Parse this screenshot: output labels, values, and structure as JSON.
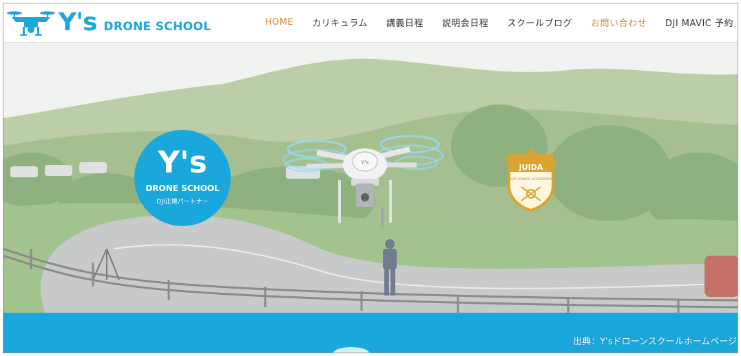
{
  "header": {
    "logo_text": "Y's",
    "logo_subtitle": "DRONE SCHOOL"
  },
  "nav": {
    "items": [
      {
        "label": "HOME"
      },
      {
        "label": "カリキュラム"
      },
      {
        "label": "講義日程"
      },
      {
        "label": "説明会日程"
      },
      {
        "label": "スクールブログ"
      },
      {
        "label": "お問い合わせ"
      },
      {
        "label": "DJI MAVIC 予約"
      }
    ]
  },
  "hero": {
    "badge_title": "Y's",
    "badge_subtitle": "DRONE SCHOOL",
    "badge_tagline": "DJI正規パートナー",
    "juida_title": "JUIDA",
    "juida_sub": "UAS SCHOOL ACCREDITED",
    "drone_label": "Y's"
  },
  "caption": "出典：Y'sドローンスクールホームページ",
  "colors": {
    "brand_blue": "#1aa7db",
    "nav_active": "#c9883a",
    "juida_gold": "#d9a432"
  }
}
